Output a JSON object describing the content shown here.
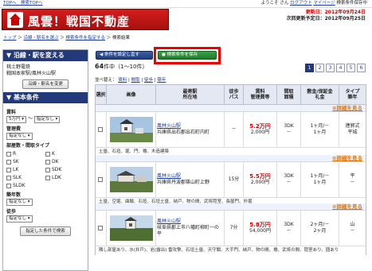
{
  "topbar": {
    "links": "TOPへ　検索TOPへ",
    "welcome_prefix": "ようこそ",
    "username": "",
    "welcome_suffix": "さん",
    "logout": "ログアウト",
    "mypage": "マイページ",
    "saved_search": "検索条件保存中"
  },
  "header": {
    "logo_text": "風雲！戦国不動産",
    "updated_label": "更新日：2012年09月24日",
    "next_update_label": "次回更新予定日：2012年09月25日"
  },
  "breadcrumb": [
    "トップ",
    "沿線・駅名を選ぶ",
    "検索条件を指定する",
    "検索結果"
  ],
  "sidebar": {
    "line_title": "沿線・駅を変える",
    "line_value": "桃土野電鉄\n戦国本家駅/風林火山駅",
    "line_button": "沿線・駅名を変更",
    "basic_title": "基本条件",
    "rent_label": "賃料",
    "rent_min": "5万円",
    "rent_sep": "～",
    "rent_max": "指定なし",
    "mgmt_label": "管理費",
    "mgmt_value": "指定なし",
    "layout_label": "部屋数・間取タイプ",
    "layouts": [
      "R",
      "K",
      "SK",
      "DK",
      "LK",
      "SDK",
      "SLK",
      "LDK",
      "SLDK"
    ],
    "age_label": "築年数",
    "age_value": "指定なし",
    "walk_label": "徒歩",
    "walk_value": "指定なし",
    "search_button": "指定した条件で検索"
  },
  "toolbar": {
    "reset_button": "条件を設定し直す",
    "save_button": "検索条件を保存"
  },
  "results": {
    "count": "64",
    "count_suffix": "件中（1〜10件）",
    "pages": [
      "1",
      "2",
      "3",
      "4",
      "5",
      "6"
    ],
    "current_page": "1",
    "sort_label": "並べ替え：",
    "sort_options": [
      "賃料",
      "間取",
      "徒歩",
      "築年"
    ]
  },
  "columns": [
    "選択",
    "画像",
    "最寄駅\n所在地",
    "徒歩\nバス",
    "賃料\n管理費等",
    "間取\n面積",
    "敷金/保証金\n礼金",
    "タイプ\n築年"
  ],
  "detail_label": "詳細を見る",
  "listings": [
    {
      "station": "風林火山駅",
      "address": "兵庫県出石郡出石町内町",
      "walk": "－",
      "rent": "5.2万円",
      "fee": "2,000円",
      "layout": "3DK",
      "area": "－",
      "deposit": "1ヶ月/－",
      "key": "1ヶ月",
      "type": "連郭式",
      "built": "平城",
      "features": "土塁、石垣、堀、門、櫓、木造建築"
    },
    {
      "station": "風林火山駅",
      "address": "兵庫県丹波郡篠山町上野",
      "walk": "15分",
      "rent": "5.5万円",
      "fee": "2,000円",
      "layout": "3DK",
      "area": "－",
      "deposit": "1ヶ月/－",
      "key": "1ヶ月",
      "type": "平",
      "built": "－",
      "features": "土塁、空堀、曲輪、石垣、石垣土塁、納戸、物の間、武将隠室、長屋門、外堀"
    },
    {
      "station": "風林火山駅",
      "address": "岐阜県郡上市八幡町柳町一の平",
      "walk": "7分",
      "rent": "5.8万円",
      "fee": "54,000円",
      "layout": "3DK",
      "area": "－",
      "deposit": "2ヶ月/－",
      "key": "2ヶ月",
      "type": "山",
      "built": "－",
      "features": "隣し部屋あり、水(井戸)、岩(露出) 雷攻撃、石垣土塁、天守閣、大手門、納戸、物の間、櫓、武将の間、隠室あり、囲あり"
    }
  ]
}
